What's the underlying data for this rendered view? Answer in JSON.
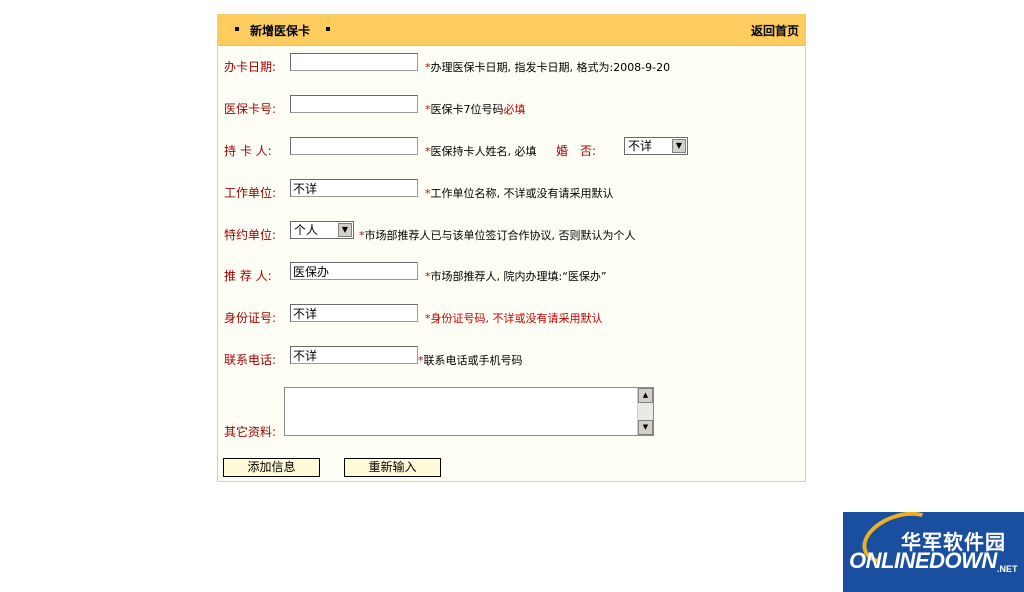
{
  "header": {
    "title": "新增医保卡",
    "home_link": "返回首页"
  },
  "form": {
    "card_date": {
      "label": "办卡日期:",
      "value": "",
      "hint": "办理医保卡日期, 指发卡日期, 格式为:2008-9-20"
    },
    "card_no": {
      "label": "医保卡号:",
      "value": "",
      "hint_prefix": "医保卡7位号码",
      "hint_required": "必填"
    },
    "holder": {
      "label": "持 卡 人:",
      "value": "",
      "hint": "医保持卡人姓名, 必填",
      "married_label": "婚　否:",
      "married_value": "不详"
    },
    "work_unit": {
      "label": "工作单位:",
      "value": "不详",
      "hint": "工作单位名称, 不详或没有请采用默认"
    },
    "contract_unit": {
      "label": "特约单位:",
      "value": "个人",
      "hint": "市场部推荐人已与该单位签订合作协议, 否则默认为个人"
    },
    "referrer": {
      "label": "推 荐 人:",
      "value": "医保办",
      "hint": "市场部推荐人, 院内办理填:“医保办”"
    },
    "id_no": {
      "label": "身份证号:",
      "value": "不详",
      "hint": "身份证号码, 不详或没有请采用默认"
    },
    "phone": {
      "label": "联系电话:",
      "value": "不详",
      "hint": "联系电话或手机号码"
    },
    "other": {
      "label": "其它资料:",
      "value": ""
    },
    "required_mark": "*"
  },
  "buttons": {
    "submit": "添加信息",
    "reset": "重新输入"
  },
  "watermark": {
    "cn": "华军软件园",
    "en": "ONLINEDOWN",
    "net": ".NET"
  },
  "colors": {
    "header_bg": "#fccc5e",
    "label_red": "#9b0000",
    "required_red": "#c00000",
    "logo_blue": "#1a4fa0"
  }
}
